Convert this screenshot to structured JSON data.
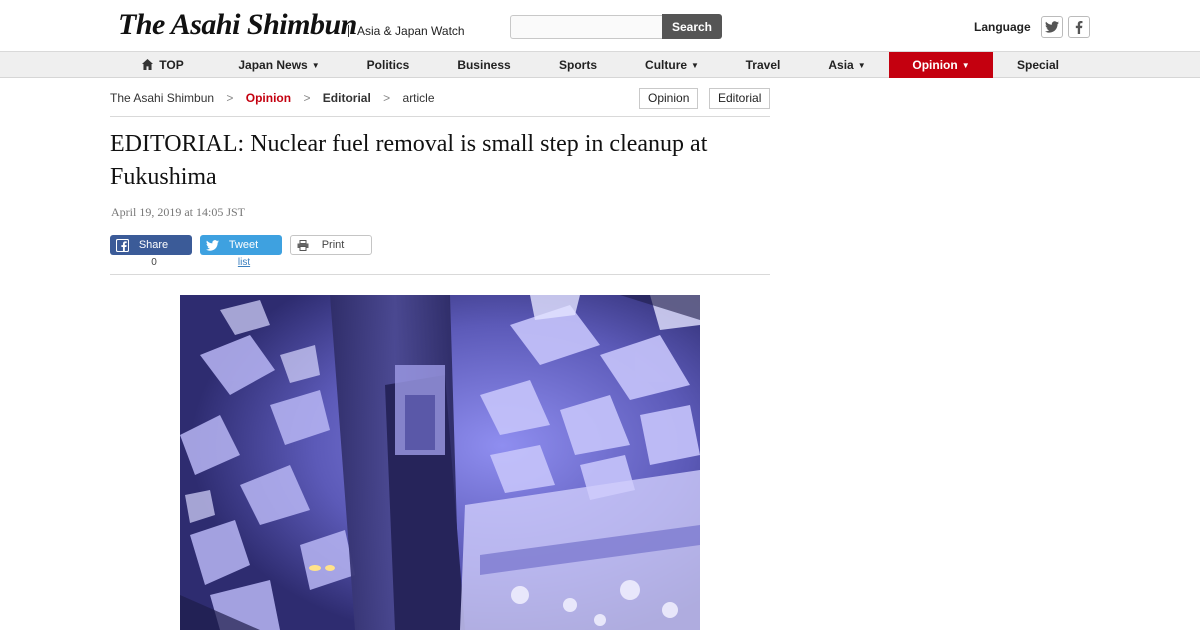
{
  "header": {
    "logo_text": "The Asahi Shimbun",
    "tagline": "Asia & Japan Watch",
    "search_placeholder": "",
    "search_button": "Search",
    "language_label": "Language",
    "social_icons": [
      "twitter-icon",
      "facebook-icon"
    ]
  },
  "nav": {
    "items": [
      {
        "label": "TOP",
        "icon": "home-icon"
      },
      {
        "label": "Japan News",
        "dropdown": true
      },
      {
        "label": "Politics"
      },
      {
        "label": "Business"
      },
      {
        "label": "Sports"
      },
      {
        "label": "Culture",
        "dropdown": true
      },
      {
        "label": "Travel"
      },
      {
        "label": "Asia",
        "dropdown": true
      },
      {
        "label": "Opinion",
        "dropdown": true,
        "active": true
      },
      {
        "label": "Special"
      }
    ],
    "caret_glyph": "▼",
    "active_color": "#c4000f"
  },
  "breadcrumb": {
    "items": [
      "The Asahi Shimbun",
      "Opinion",
      "Editorial",
      "article"
    ],
    "separator": ">"
  },
  "tags": [
    "Opinion",
    "Editorial"
  ],
  "article": {
    "headline": "EDITORIAL: Nuclear fuel removal is small step in cleanup at Fukushima",
    "dateline": "April 19, 2019 at 14:05 JST"
  },
  "share": {
    "facebook_label": "Share",
    "facebook_count": "0",
    "twitter_label": "Tweet",
    "twitter_sub": "list",
    "print_label": "Print"
  },
  "colors": {
    "accent": "#c4000f",
    "facebook": "#3b5b98",
    "twitter": "#3ea1e0"
  }
}
